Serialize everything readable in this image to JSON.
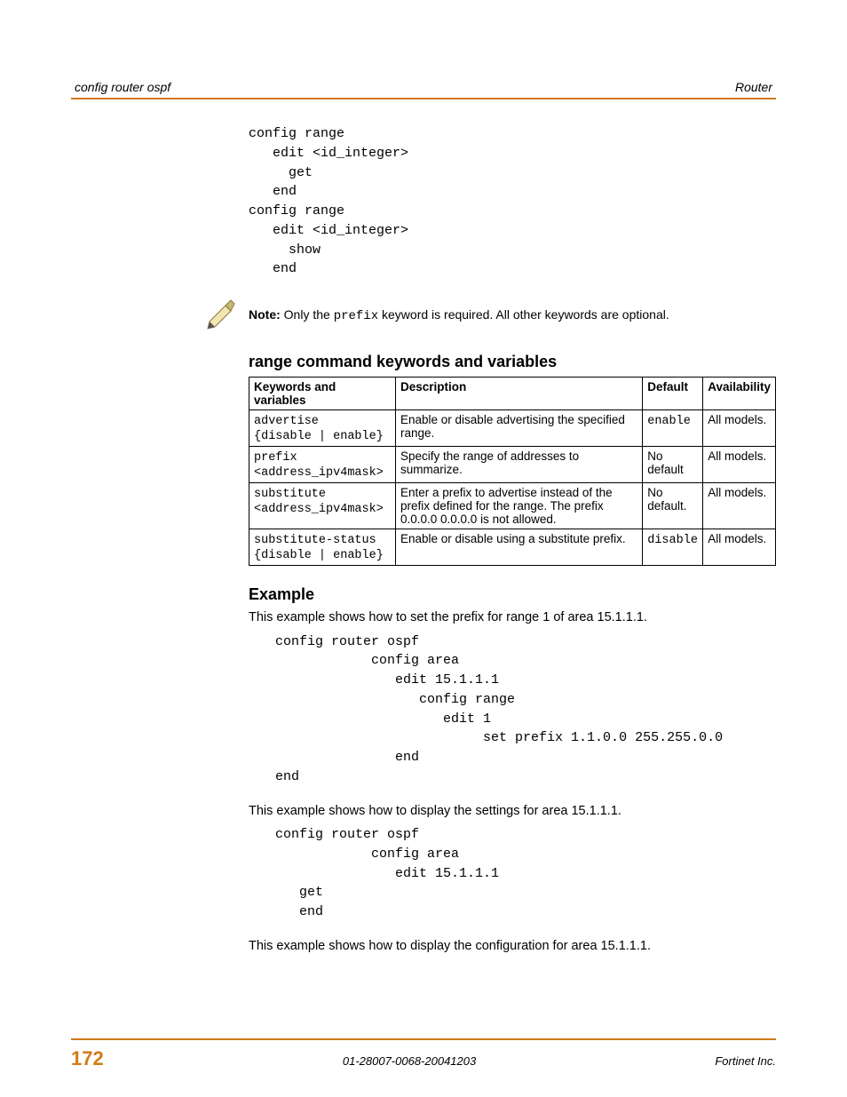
{
  "header": {
    "left": "config router ospf",
    "right": "Router"
  },
  "code1": "config range\n   edit <id_integer>\n     get\n   end\nconfig range\n   edit <id_integer>\n     show\n   end",
  "note": {
    "bold": "Note:",
    "before": " Only the ",
    "mono": "prefix",
    "after": " keyword is required. All other keywords are optional."
  },
  "table": {
    "title": "range command keywords and variables",
    "headers": {
      "c0": "Keywords and variables",
      "c1": "Description",
      "c2": "Default",
      "c3": "Availability"
    },
    "rows": [
      {
        "kw_line1": "advertise",
        "kw_line2": "{disable | enable}",
        "desc": "Enable or disable advertising the specified range.",
        "def": "enable",
        "def_mono": true,
        "avail": "All models."
      },
      {
        "kw_line1": "prefix",
        "kw_line2": "<address_ipv4mask>",
        "desc": "Specify the range of addresses to summarize.",
        "def": "No default",
        "def_mono": false,
        "avail": "All models."
      },
      {
        "kw_line1": "substitute",
        "kw_line2": "<address_ipv4mask>",
        "desc": "Enter a prefix to advertise instead of the prefix defined for the range. The prefix 0.0.0.0 0.0.0.0 is not allowed.",
        "def": "No default.",
        "def_mono": false,
        "avail": "All models."
      },
      {
        "kw_line1": "substitute-status",
        "kw_line2": "{disable | enable}",
        "desc": "Enable or disable using a substitute prefix.",
        "def": "disable",
        "def_mono": true,
        "avail": "All models."
      }
    ]
  },
  "example": {
    "heading": "Example",
    "intro1": "This example shows how to set the prefix for range 1 of area 15.1.1.1.",
    "code1": "config router ospf\n            config area\n               edit 15.1.1.1\n                  config range\n                     edit 1\n                          set prefix 1.1.0.0 255.255.0.0\n               end\nend",
    "intro2": "This example shows how to display the settings for area 15.1.1.1.",
    "code2": "config router ospf\n            config area\n               edit 15.1.1.1\n   get\n   end",
    "intro3": "This example shows how to display the configuration for area 15.1.1.1."
  },
  "footer": {
    "page": "172",
    "docid": "01-28007-0068-20041203",
    "company": "Fortinet Inc."
  }
}
